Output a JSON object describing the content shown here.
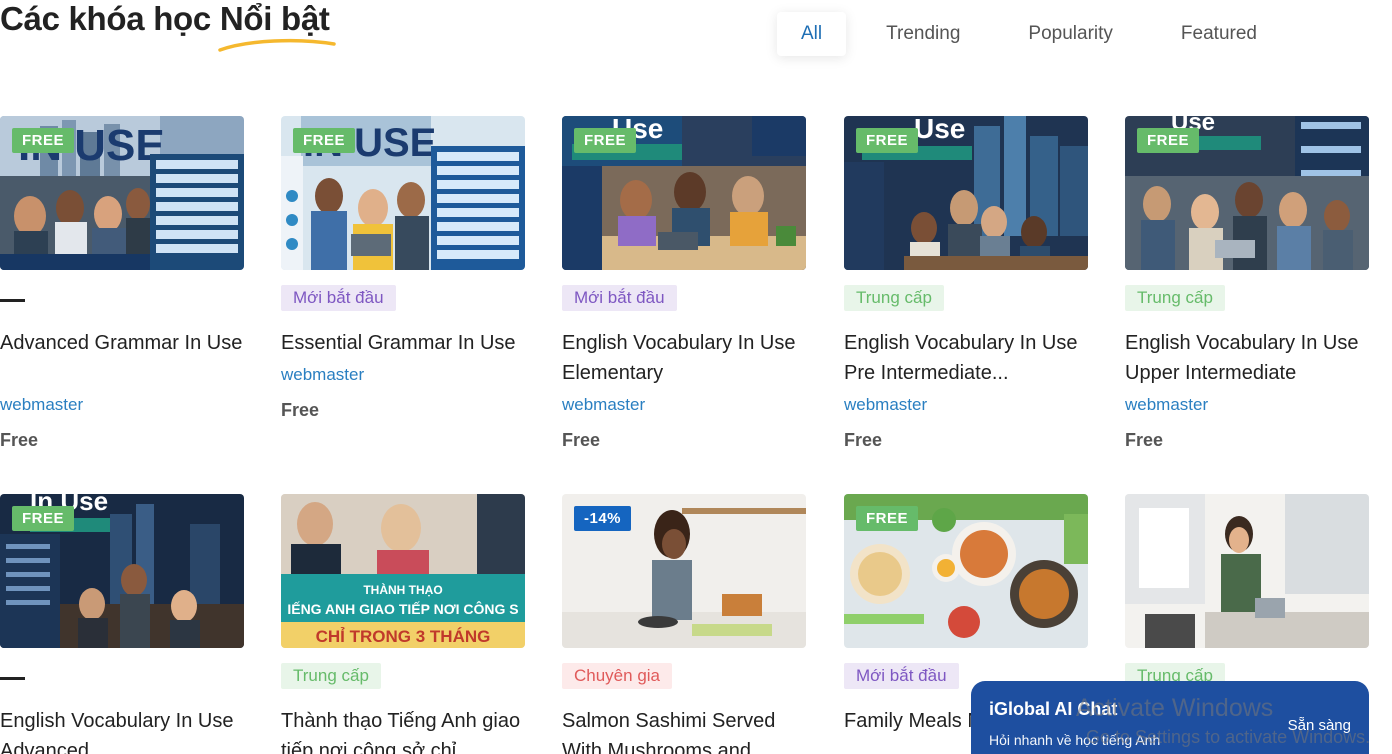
{
  "section": {
    "title_plain": "Các khóa học ",
    "title_highlight": "Nổi bật"
  },
  "filters": [
    "All",
    "Trending",
    "Popularity",
    "Featured"
  ],
  "courses": [
    {
      "badge": "FREE",
      "level": "",
      "title": "Advanced Grammar In Use",
      "author": "webmaster",
      "price": "Free"
    },
    {
      "badge": "FREE",
      "level": "Mới bắt đầu",
      "title": "Essential Grammar In Use",
      "author": "webmaster",
      "price": "Free"
    },
    {
      "badge": "FREE",
      "level": "Mới bắt đầu",
      "title": "English Vocabulary In Use Elementary",
      "author": "webmaster",
      "price": "Free"
    },
    {
      "badge": "FREE",
      "level": "Trung cấp",
      "title": "English Vocabulary In Use Pre Intermediate...",
      "author": "webmaster",
      "price": "Free"
    },
    {
      "badge": "FREE",
      "level": "Trung cấp",
      "title": "English Vocabulary In Use Upper Intermediate",
      "author": "webmaster",
      "price": "Free"
    },
    {
      "badge": "FREE",
      "level": "",
      "title": "English Vocabulary In Use Advanced",
      "author": "",
      "price": ""
    },
    {
      "badge": "",
      "level": "Trung cấp",
      "title": "Thành thạo Tiếng Anh giao tiếp nơi công sở chỉ",
      "author": "",
      "price": "",
      "banner_line1": "THÀNH THẠO",
      "banner_line2": "IẾNG ANH GIAO TIẾP NƠI CÔNG S",
      "banner_line3": "CHỈ TRONG 3 THÁNG"
    },
    {
      "badge": "-14%",
      "level": "Chuyên gia",
      "title": "Salmon Sashimi Served With Mushrooms and",
      "author": "",
      "price": ""
    },
    {
      "badge": "FREE",
      "level": "Mới bắt đầu",
      "title": "Family Meals Nutrition",
      "author": "",
      "price": ""
    },
    {
      "badge": "",
      "level": "Trung cấp",
      "title": "",
      "author": "",
      "price": ""
    }
  ],
  "chat": {
    "title": "iGlobal AI Chat",
    "subtitle": "Hỏi nhanh về học tiếng Anh",
    "status": "Sẵn sàng"
  },
  "watermark": {
    "line1": "Activate Windows",
    "line2": "Go to Settings to activate Windows."
  },
  "colors": {
    "accent_blue": "#2a7fc1",
    "free_badge": "#66bb6a",
    "sale_badge": "#1565c0",
    "highlight_underline": "#f5b82e",
    "chat_bg": "#1e4fa0"
  }
}
